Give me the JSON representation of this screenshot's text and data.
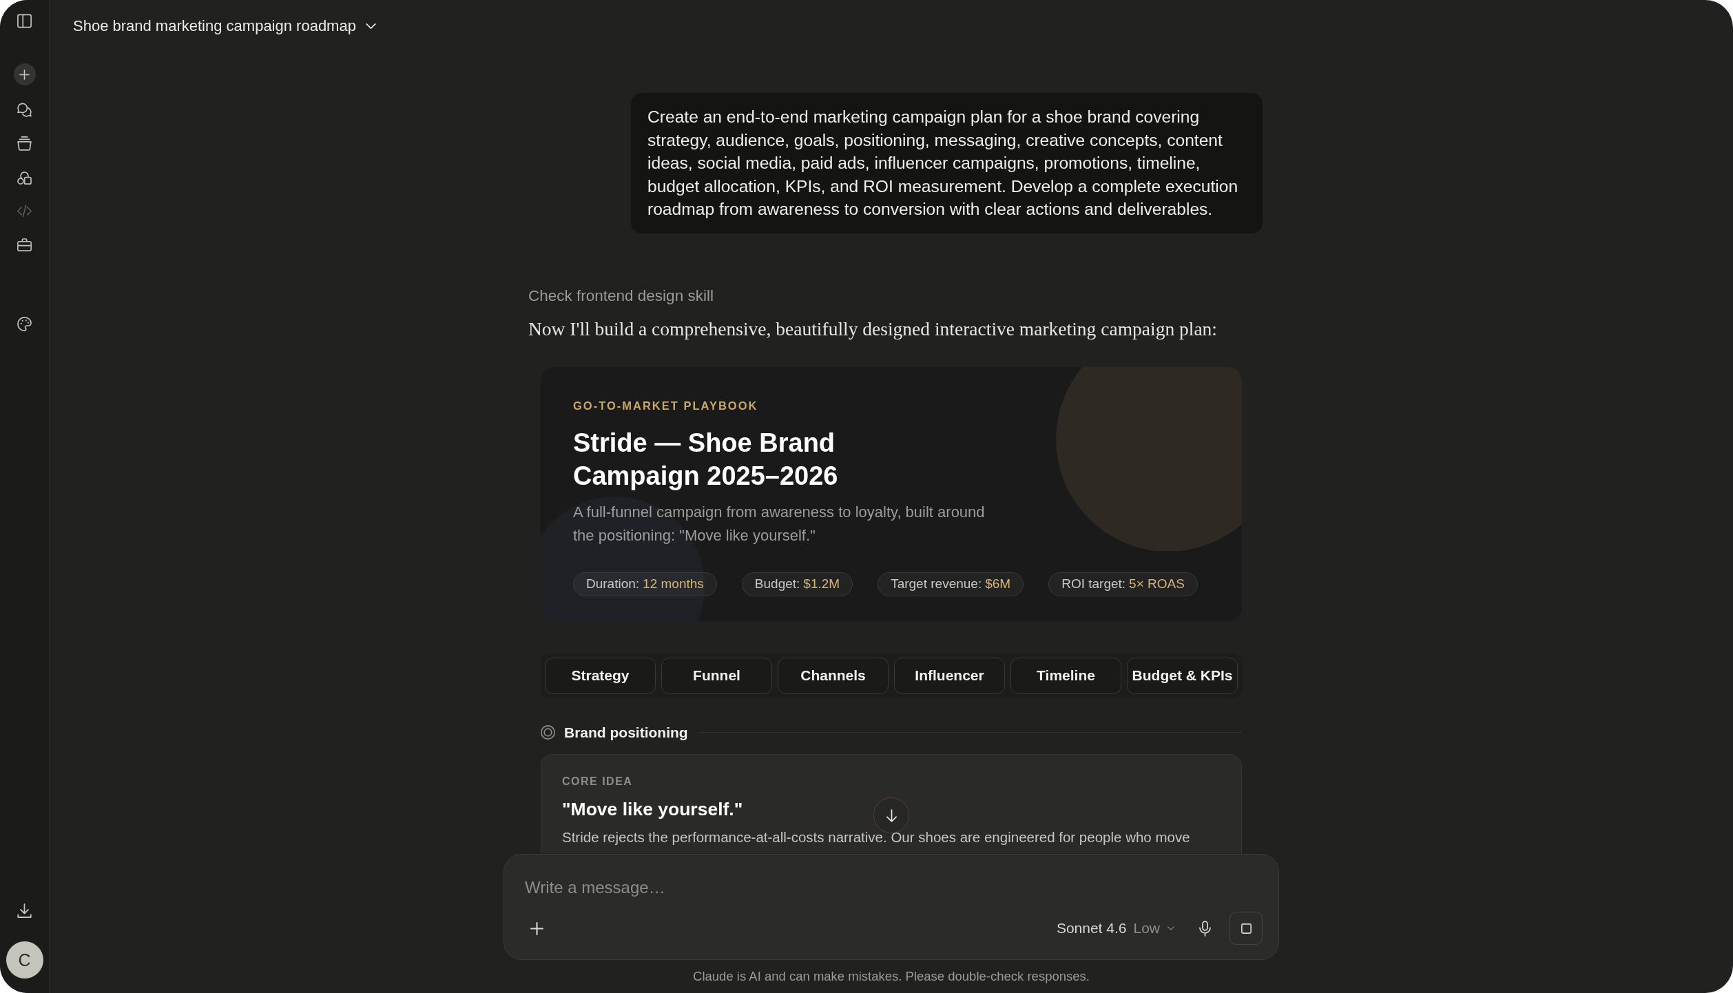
{
  "window": {
    "title": "Shoe brand marketing campaign roadmap"
  },
  "sidebar": {
    "top": [
      {
        "kind": "sidebar-toggle",
        "disabled": false
      },
      {
        "kind": "new-chat",
        "disabled": false
      },
      {
        "kind": "chats",
        "disabled": false
      },
      {
        "kind": "projects",
        "disabled": false
      },
      {
        "kind": "artifacts",
        "disabled": false
      },
      {
        "kind": "code",
        "disabled": true
      },
      {
        "kind": "briefcase",
        "disabled": false
      }
    ],
    "middle": [
      {
        "kind": "palette",
        "disabled": false
      }
    ],
    "bottom": [
      {
        "kind": "download",
        "disabled": false
      }
    ],
    "avatar": "C"
  },
  "conversation": {
    "user_message": "Create an end-to-end marketing campaign plan for a shoe brand covering strategy, audience, goals, positioning, messaging, creative concepts, content ideas, social media, paid ads, influencer campaigns, promotions, timeline, budget allocation, KPIs, and ROI measurement. Develop a complete execution roadmap from awareness to conversion with clear actions and deliverables.",
    "tool_step": "Check frontend design skill",
    "assistant_text": "Now I'll build a comprehensive, beautifully designed interactive marketing campaign plan:",
    "artifact": {
      "hero": {
        "eyebrow": "GO-TO-MARKET PLAYBOOK",
        "title": "Stride — Shoe Brand Campaign 2025–2026",
        "subtitle": "A full-funnel campaign from awareness to loyalty, built around the positioning: \"Move like yourself.\"",
        "stats": [
          {
            "label": "Duration:",
            "value": "12 months"
          },
          {
            "label": "Budget:",
            "value": "$1.2M"
          },
          {
            "label": "Target revenue:",
            "value": "$6M"
          },
          {
            "label": "ROI target:",
            "value": "5× ROAS"
          }
        ]
      },
      "tabs": [
        "Strategy",
        "Funnel",
        "Channels",
        "Influencer",
        "Timeline",
        "Budget & KPIs"
      ],
      "section": {
        "title": "Brand positioning",
        "card": {
          "eyebrow": "CORE IDEA",
          "heading": "\"Move like yourself.\"",
          "body": "Stride rejects the performance-at-all-costs narrative. Our shoes are engineered for people who move"
        }
      }
    }
  },
  "composer": {
    "placeholder": "Write a message…",
    "model": "Sonnet 4.6",
    "effort": "Low"
  },
  "disclaimer": "Claude is AI and can make mistakes. Please double-check responses."
}
